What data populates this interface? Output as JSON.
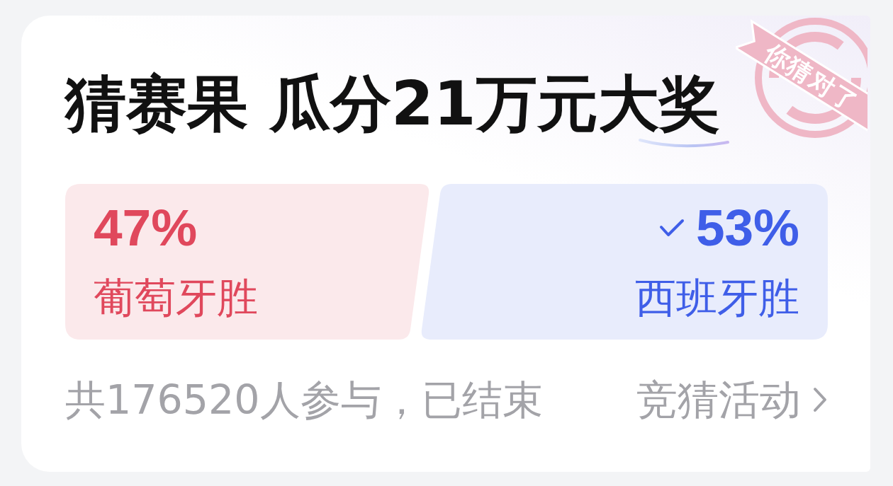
{
  "card": {
    "title": "猜赛果 瓜分21万元大奖",
    "stamp": "你猜对了"
  },
  "options": [
    {
      "percent": "47%",
      "label": "葡萄牙胜",
      "color": "#e0485c",
      "selected": false
    },
    {
      "percent": "53%",
      "label": "西班牙胜",
      "color": "#3f5ee8",
      "selected": true
    }
  ],
  "footer": {
    "summary": "共176520人参与，已结束",
    "link": "竞猜活动"
  }
}
